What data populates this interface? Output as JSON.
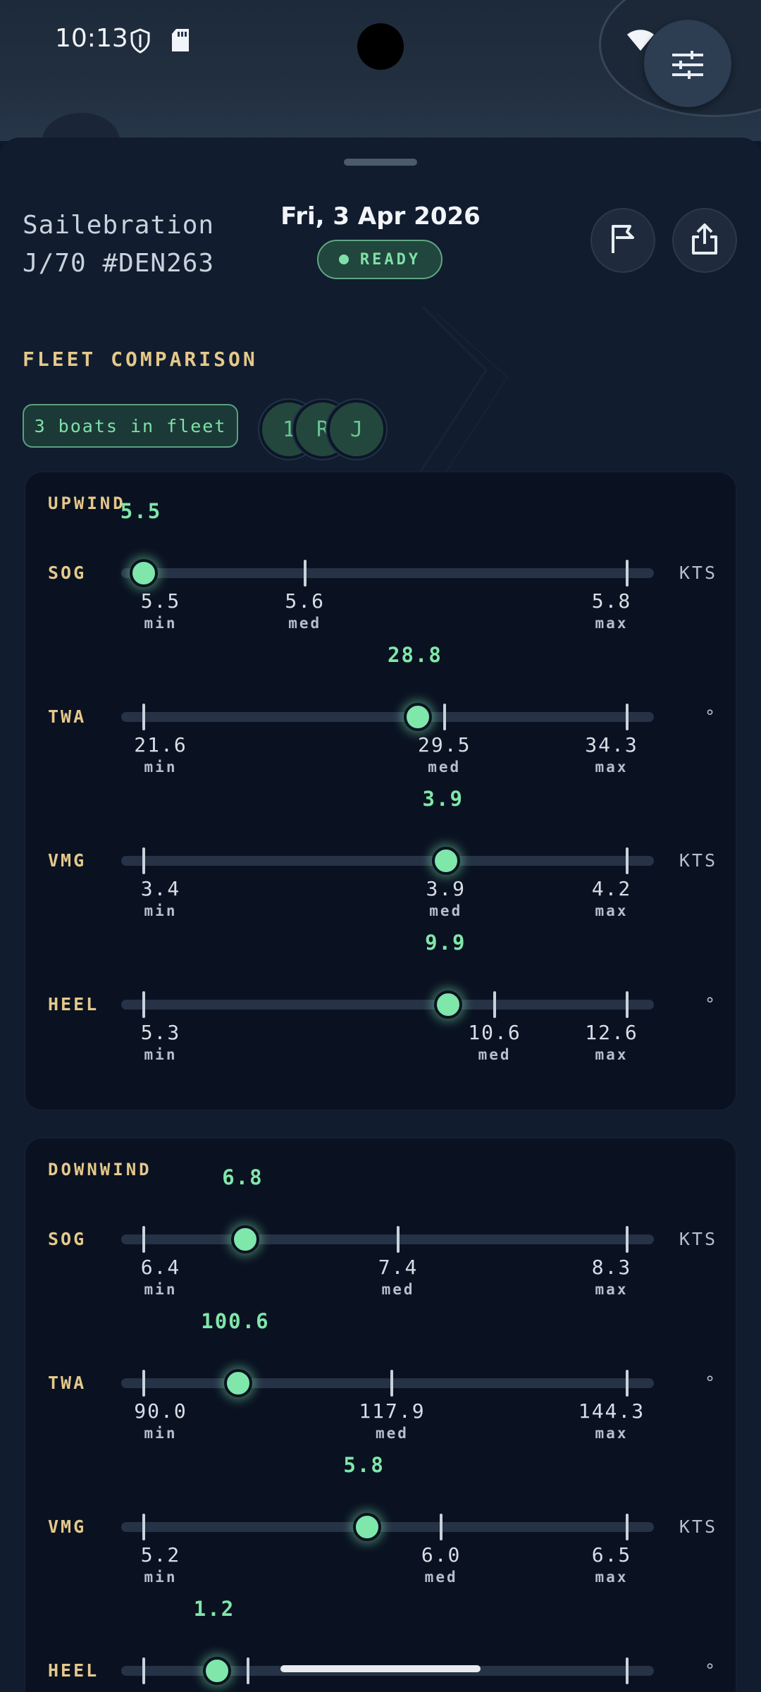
{
  "status_bar": {
    "time": "10:13",
    "icons": [
      "shield-icon",
      "sd-card-icon",
      "wifi-icon",
      "signal-icon",
      "battery-icon"
    ]
  },
  "header": {
    "boat_name": "Sailebration",
    "boat_class": "J/70 #DEN263",
    "date": "Fri, 3 Apr 2026",
    "status_badge": "READY",
    "buttons": [
      "flag-icon",
      "share-icon"
    ]
  },
  "fleet": {
    "section_title": "FLEET COMPARISON",
    "chip_label": "3 boats in fleet",
    "avatars": [
      "1",
      "R",
      "J"
    ]
  },
  "upwind": {
    "title": "UPWIND",
    "metrics": [
      {
        "label": "SOG",
        "unit": "KTS",
        "value": "5.5",
        "min": "5.5",
        "med": "5.6",
        "max": "5.8",
        "value_num": 5.5,
        "min_num": 5.5,
        "med_num": 5.6,
        "max_num": 5.8
      },
      {
        "label": "TWA",
        "unit": "°",
        "value": "28.8",
        "min": "21.6",
        "med": "29.5",
        "max": "34.3",
        "value_num": 28.8,
        "min_num": 21.6,
        "med_num": 29.5,
        "max_num": 34.3
      },
      {
        "label": "VMG",
        "unit": "KTS",
        "value": "3.9",
        "min": "3.4",
        "med": "3.9",
        "max": "4.2",
        "value_num": 3.9,
        "min_num": 3.4,
        "med_num": 3.9,
        "max_num": 4.2
      },
      {
        "label": "HEEL",
        "unit": "°",
        "value": "9.9",
        "min": "5.3",
        "med": "10.6",
        "max": "12.6",
        "value_num": 9.9,
        "min_num": 5.3,
        "med_num": 10.6,
        "max_num": 12.6
      }
    ]
  },
  "downwind": {
    "title": "DOWNWIND",
    "metrics": [
      {
        "label": "SOG",
        "unit": "KTS",
        "value": "6.8",
        "min": "6.4",
        "med": "7.4",
        "max": "8.3",
        "value_num": 6.8,
        "min_num": 6.4,
        "med_num": 7.4,
        "max_num": 8.3
      },
      {
        "label": "TWA",
        "unit": "°",
        "value": "100.6",
        "min": "90.0",
        "med": "117.9",
        "max": "144.3",
        "value_num": 100.6,
        "min_num": 90.0,
        "med_num": 117.9,
        "max_num": 144.3
      },
      {
        "label": "VMG",
        "unit": "KTS",
        "value": "5.8",
        "min": "5.2",
        "med": "6.0",
        "max": "6.5",
        "value_num": 5.8,
        "min_num": 5.2,
        "med_num": 6.0,
        "max_num": 6.5
      },
      {
        "label": "HEEL",
        "unit": "°",
        "value": "1.2",
        "value_num": 1.2
      }
    ]
  },
  "min_label": "min",
  "med_label": "med",
  "max_label": "max",
  "colors": {
    "accent_green": "#7fe7a9",
    "label_gold": "#e5c98a",
    "background": "#111c2e",
    "card": "#0a1222"
  }
}
